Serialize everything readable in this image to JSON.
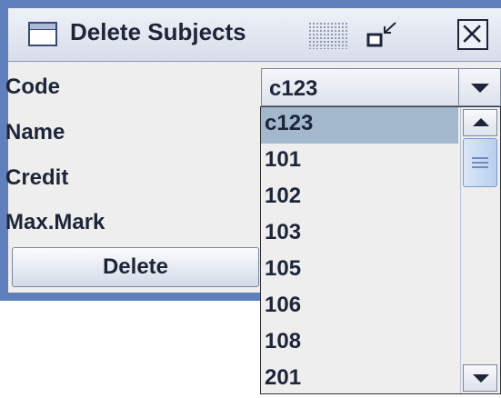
{
  "window": {
    "title": "Delete Subjects",
    "icons": {
      "window": "window-icon",
      "restore": "restore-icon",
      "close": "close-icon"
    }
  },
  "form": {
    "code_label": "Code",
    "name_label": "Name",
    "credit_label": "Credit",
    "maxmark_label": "Max.Mark",
    "code_value": "c123",
    "delete_label": "Delete"
  },
  "dropdown": {
    "selected": "c123",
    "options": [
      "c123",
      "101",
      "102",
      "103",
      "105",
      "106",
      "108",
      "201"
    ]
  },
  "colors": {
    "frame": "#5f7fbd",
    "selection": "#a3b8cc",
    "panel": "#eeeeee"
  }
}
